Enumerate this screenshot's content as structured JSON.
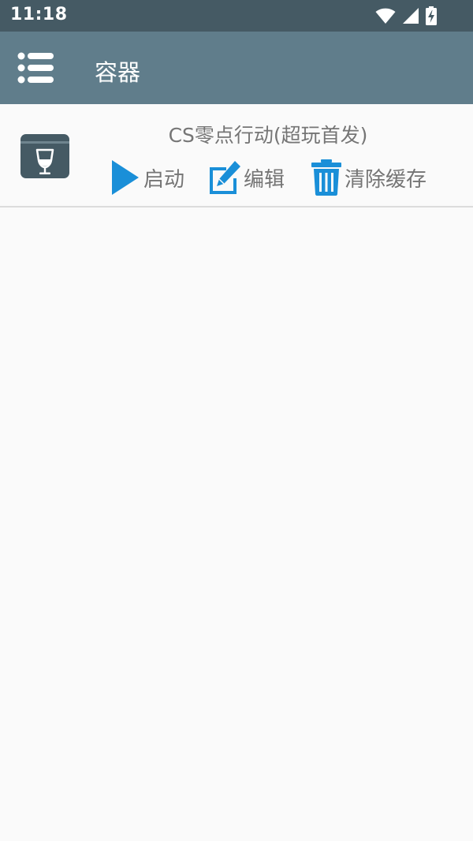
{
  "status_bar": {
    "time": "11:18",
    "icons": [
      "wifi-icon",
      "cell-signal-icon",
      "battery-charging-icon"
    ]
  },
  "app_bar": {
    "menu_icon": "menu-list-icon",
    "title": "容器"
  },
  "containers": [
    {
      "icon": "wine-glass-box-icon",
      "name": "CS零点行动(超玩首发)",
      "actions": {
        "start": {
          "icon": "play-icon",
          "label": "启动"
        },
        "edit": {
          "icon": "edit-icon",
          "label": "编辑"
        },
        "clear_cache": {
          "icon": "trash-icon",
          "label": "清除缓存"
        }
      }
    }
  ],
  "colors": {
    "status_bar": "#455a64",
    "app_bar": "#607d8b",
    "accent": "#1a8fd8",
    "text_secondary": "#757575",
    "background": "#fafafa"
  }
}
